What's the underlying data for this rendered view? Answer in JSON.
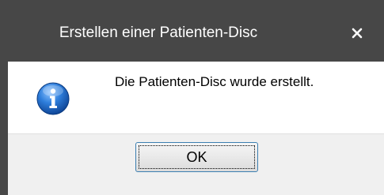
{
  "window": {
    "title": "Erstellen einer Patienten-Disc",
    "close_icon": "close-icon"
  },
  "message": {
    "icon": "info-icon",
    "text": "Die Patienten-Disc wurde erstellt."
  },
  "buttons": {
    "ok_label": "OK"
  },
  "colors": {
    "titlebar": "#474747",
    "title_text": "#ffffff",
    "content_bg": "#ffffff",
    "button_area_bg": "#f0f0f0",
    "button_focus_border": "#3c7fb1",
    "info_icon_blue": "#1f63b8"
  }
}
